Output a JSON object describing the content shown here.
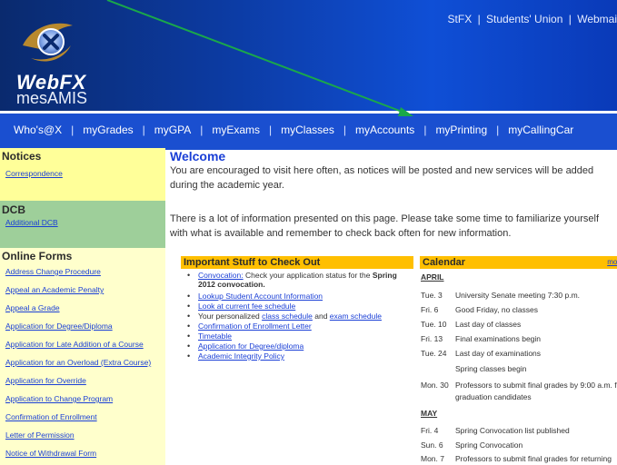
{
  "header": {
    "logo_icon": "xavier-x-logo-icon",
    "brand_title": "WebFX",
    "brand_subtitle": "mesAMIS",
    "top_links": [
      "StFX",
      "Students' Union",
      "Webmai"
    ],
    "top_sep": "|"
  },
  "nav": {
    "separator": "|",
    "items": [
      "Who's@X",
      "myGrades",
      "myGPA",
      "myExams",
      "myClasses",
      "myAccounts",
      "myPrinting",
      "myCallingCar"
    ]
  },
  "sidebar": {
    "notices_title": "Notices",
    "notices_links": [
      "Correspondence"
    ],
    "dcb_title": "DCB",
    "dcb_links": [
      "Additional DCB"
    ],
    "forms_title": "Online Forms",
    "forms_links": [
      "Address Change Procedure",
      "Appeal an Academic Penalty",
      "Appeal a Grade",
      "Application for Degree/Diploma",
      "Application for Late Addition of a Course",
      "Application for an Overload (Extra Course)",
      "Application for Override",
      "Application to Change Program",
      "Confirmation of Enrollment",
      "Letter of Permission",
      "Notice of Withdrawal Form"
    ]
  },
  "main": {
    "welcome_title": "Welcome",
    "welcome_p1": "You are encouraged to visit here often, as notices will be posted and new services will be added during the academic year.",
    "welcome_p2": "There is a lot of information presented on this page. Please take some time to familiarize yourself with what is available and remember to check back often for new information."
  },
  "important": {
    "title": "Important Stuff to Check Out",
    "item1_link": "Convocation:",
    "item1_text": " Check your application status for the ",
    "item1_bold": "Spring 2012 convocation.",
    "item2": "Lookup Student Account Information",
    "item3": "Look at current fee schedule",
    "item4_pre": "Your personalized ",
    "item4_link1": "class schedule",
    "item4_mid": " and ",
    "item4_link2": "exam schedule",
    "item5": "Confirmation of Enrollment Letter",
    "item6": "Timetable",
    "item7": "Application for Degree/diploma",
    "item8": "Academic Integrity Policy"
  },
  "calendar": {
    "title": "Calendar",
    "more_label": "mor",
    "month1": "APRIL",
    "april": [
      {
        "date": "Tue. 3",
        "event": "University Senate meeting 7:30 p.m."
      },
      {
        "date": "Fri. 6",
        "event": "Good Friday, no classes"
      },
      {
        "date": "Tue. 10",
        "event": "Last day of classes"
      },
      {
        "date": "Fri. 13",
        "event": "Final examinations begin"
      },
      {
        "date": "Tue. 24",
        "event": "Last day of examinations"
      },
      {
        "date": "",
        "event": "Spring classes begin"
      },
      {
        "date": "Mon. 30",
        "event": "Professors to submit final grades by 9:00 a.m. fo"
      },
      {
        "date": "",
        "event": "graduation candidates"
      }
    ],
    "month2": "MAY",
    "may": [
      {
        "date": "Fri. 4",
        "event": "Spring Convocation list published"
      },
      {
        "date": "Sun. 6",
        "event": "Spring Convocation"
      },
      {
        "date": "Mon. 7",
        "event": "Professors to submit final grades for returning"
      }
    ]
  },
  "colors": {
    "header_bg": "#0c3aa0",
    "nav_bg": "#1a4fd0",
    "notices_bg": "#ffff99",
    "dcb_bg": "#9ecf9a",
    "forms_bg": "#ffffcc",
    "panel_head": "#ffbf00",
    "link": "#1a3fd6",
    "arrow": "#1aa84a"
  }
}
